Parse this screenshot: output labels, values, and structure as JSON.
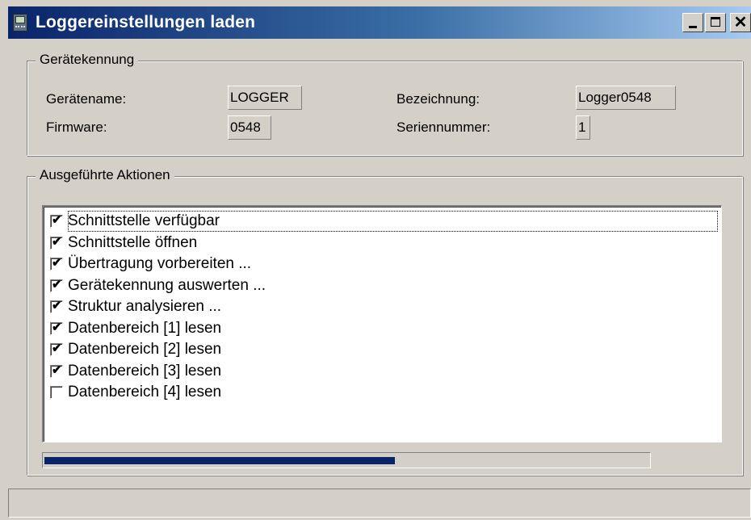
{
  "window": {
    "title": "Loggereinstellungen laden",
    "close_glyph": "✕"
  },
  "device_group": {
    "legend": "Gerätekennung",
    "fields": {
      "device_name": {
        "label": "Gerätename:",
        "value": "LOGGER"
      },
      "firmware": {
        "label": "Firmware:",
        "value": "0548"
      },
      "designation": {
        "label": "Bezeichnung:",
        "value": "Logger0548"
      },
      "serial": {
        "label": "Seriennummer:",
        "value": "1"
      }
    }
  },
  "actions_group": {
    "legend": "Ausgeführte Aktionen",
    "items": [
      {
        "label": "Schnittstelle verfügbar",
        "checked": true
      },
      {
        "label": "Schnittstelle öffnen",
        "checked": true
      },
      {
        "label": "Übertragung vorbereiten ...",
        "checked": true
      },
      {
        "label": "Gerätekennung auswerten ...",
        "checked": true
      },
      {
        "label": "Struktur analysieren ...",
        "checked": true
      },
      {
        "label": "Datenbereich [1] lesen",
        "checked": true
      },
      {
        "label": "Datenbereich [2] lesen",
        "checked": true
      },
      {
        "label": "Datenbereich [3] lesen",
        "checked": true
      },
      {
        "label": "Datenbereich [4] lesen",
        "checked": false
      }
    ]
  },
  "progress": {
    "fraction": 0.58
  },
  "status": {
    "text": ""
  },
  "icons": {
    "app": "logger-device-icon",
    "check": "checkmark-icon"
  }
}
